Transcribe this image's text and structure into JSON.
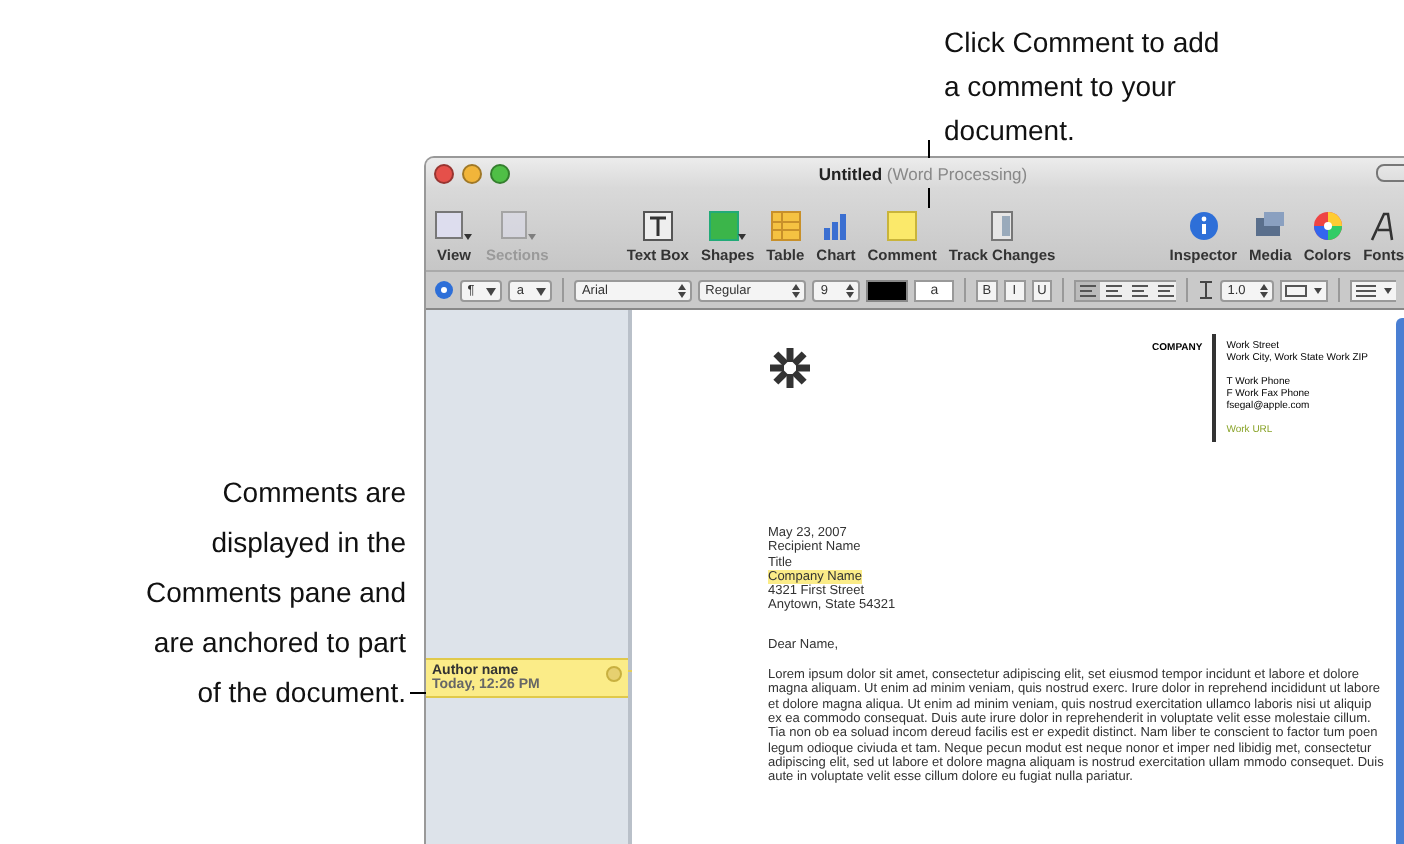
{
  "callouts": [
    {
      "kind": "top",
      "lines": [
        "Click Comment to add",
        "a comment to your",
        "document."
      ]
    },
    {
      "kind": "left",
      "lines": [
        "Comments are",
        "displayed in the",
        "Comments pane and",
        "are anchored to part",
        "of the document."
      ]
    }
  ],
  "window": {
    "title": "Untitled",
    "subtitle": "(Word Processing)"
  },
  "toolbar": [
    {
      "kind": "view",
      "label": "View",
      "disabled": false
    },
    {
      "kind": "sections",
      "label": "Sections",
      "disabled": true
    },
    {
      "kind": "gap"
    },
    {
      "kind": "textbox",
      "label": "Text Box",
      "disabled": false
    },
    {
      "kind": "shapes",
      "label": "Shapes",
      "disabled": false
    },
    {
      "kind": "table",
      "label": "Table",
      "disabled": false
    },
    {
      "kind": "chart",
      "label": "Chart",
      "disabled": false
    },
    {
      "kind": "comment",
      "label": "Comment",
      "disabled": false
    },
    {
      "kind": "track",
      "label": "Track Changes",
      "disabled": false
    },
    {
      "kind": "gap"
    },
    {
      "kind": "inspector",
      "label": "Inspector",
      "disabled": false
    },
    {
      "kind": "media",
      "label": "Media",
      "disabled": false
    },
    {
      "kind": "colors",
      "label": "Colors",
      "disabled": false
    },
    {
      "kind": "fonts",
      "label": "Fonts",
      "disabled": false
    }
  ],
  "format_bar": {
    "paragraph_style": "¶",
    "character_style": "a",
    "font": "Arial",
    "typeface": "Regular",
    "size": "9",
    "highlight_sample": "a",
    "styles": [
      "B",
      "I",
      "U"
    ],
    "line_spacing": "1.0"
  },
  "comment": {
    "author": "Author name",
    "time": "Today, 12:26 PM"
  },
  "document": {
    "company": "COMPANY",
    "contact": [
      {
        "text": "Work Street",
        "kind": "line"
      },
      {
        "text": "Work City, Work State Work ZIP",
        "kind": "line"
      },
      {
        "text": "T Work Phone",
        "kind": "gap-before"
      },
      {
        "text": "F Work Fax Phone",
        "kind": "line"
      },
      {
        "text": "fsegal@apple.com",
        "kind": "line"
      },
      {
        "text": "Work URL",
        "kind": "link"
      }
    ],
    "address": [
      {
        "text": "May 23, 2007",
        "highlighted": false
      },
      {
        "text": "Recipient Name",
        "highlighted": false
      },
      {
        "text": "Title",
        "highlighted": false
      },
      {
        "text": "Company Name",
        "highlighted": true
      },
      {
        "text": "4321 First Street",
        "highlighted": false
      },
      {
        "text": "Anytown, State 54321",
        "highlighted": false
      }
    ],
    "greeting": "Dear Name,",
    "body": "Lorem ipsum dolor sit amet, consectetur adipiscing elit, set eiusmod tempor incidunt et labore et dolore magna aliquam. Ut enim ad minim veniam, quis nostrud exerc. Irure dolor in reprehend incididunt ut labore et dolore magna aliqua. Ut enim ad minim veniam, quis nostrud exercitation ullamco laboris nisi ut aliquip ex ea commodo consequat. Duis aute irure dolor in reprehenderit in voluptate velit esse molestaie cillum. Tia non ob ea soluad incom dereud facilis est er expedit distinct. Nam liber te conscient to factor tum poen legum odioque civiuda et tam. Neque pecun modut est neque nonor et imper ned libidig met, consectetur adipiscing elit, sed ut labore et dolore magna aliquam is nostrud exercitation ullam mmodo consequet. Duis aute in voluptate velit esse cillum dolore eu fugiat nulla pariatur."
  }
}
